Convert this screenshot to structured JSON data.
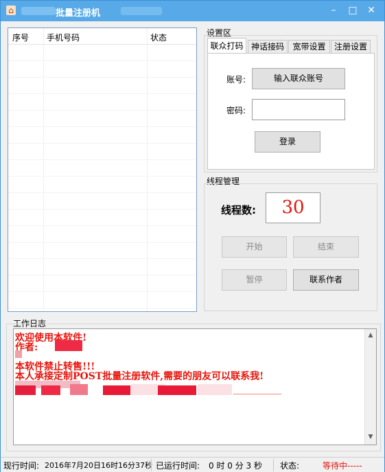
{
  "window": {
    "title": "批量注册机"
  },
  "titlebar": {
    "minimize": "–",
    "maximize": "□",
    "close": "✕",
    "app_icon": "app-icon"
  },
  "list": {
    "columns": [
      "序号",
      "手机号码",
      "状态"
    ]
  },
  "settings": {
    "group_title": "设置区",
    "tabs": [
      "联众打码",
      "神话接码",
      "宽带设置",
      "注册设置"
    ],
    "active_tab": 0,
    "account_label": "账号:",
    "account_button": "输入联众账号",
    "password_label": "密码:",
    "password_value": "",
    "login_button": "登录"
  },
  "threads": {
    "group_title": "线程管理",
    "count_label": "线程数:",
    "count_value": "30",
    "start_button": "开始",
    "end_button": "结束",
    "pause_button": "暂停",
    "contact_button": "联系作者"
  },
  "log": {
    "group_title": "工作日志",
    "lines": [
      "欢迎使用本软件!",
      "作者:",
      "本软件禁止转售!!!",
      "本人承接定制POST批量注册软件,需要的朋友可以联系我!"
    ],
    "trailing_dashes": "__________"
  },
  "status": {
    "now_label": "现行时间:",
    "now_value": "2016年7月20日16时16分37秒",
    "elapsed_label": "已运行时间:",
    "elapsed_value": "0 时 0 分 3 秒",
    "state_label": "状态:",
    "state_value": "等待中-----"
  },
  "colors": {
    "titlebar": "#58a9e8",
    "log_text": "#e8140c",
    "thread_value": "#e8140c"
  }
}
